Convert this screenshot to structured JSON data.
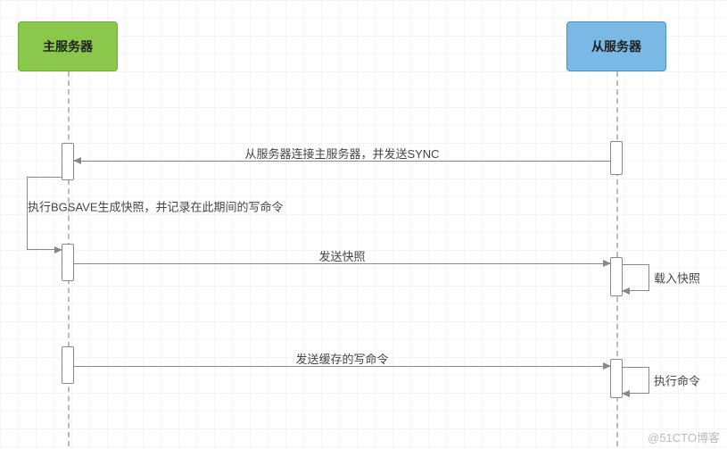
{
  "participants": {
    "master": "主服务器",
    "slave": "从服务器"
  },
  "messages": {
    "m1_sync": "从服务器连接主服务器，并发送SYNC",
    "m2_bgsave": "执行BGSAVE生成快照，并记录在此期间的写命令",
    "m3_send_snapshot": "发送快照",
    "m4_load_snapshot": "载入快照",
    "m5_send_buffered": "发送缓存的写命令",
    "m6_exec_cmds": "执行命令"
  },
  "watermark": "@51CTO博客"
}
